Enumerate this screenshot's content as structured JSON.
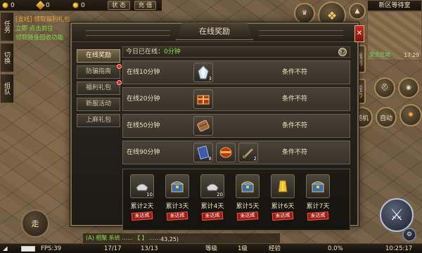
{
  "hud": {
    "res1": "0",
    "res2": "0",
    "res3": "0",
    "status_btn": "状 态",
    "recharge_btn": "充 值",
    "quest_tabs": [
      "任务",
      "切换",
      "组队"
    ],
    "quest_line1": "[支线] 领取福利礼包",
    "quest_line2": "立即 点击前往",
    "quest_line3": "领取随身回收功能",
    "minimap_title": "新区等待室",
    "safe_area": "安全区域",
    "minimap_time": "17:29",
    "welfare": "福利",
    "right_buttons": [
      "周历",
      "随机",
      "自动"
    ]
  },
  "dialog": {
    "title": "在线奖励",
    "close": "✕",
    "side_menu": [
      {
        "label": "在线奖励",
        "active": true,
        "dot": false
      },
      {
        "label": "防骗指南",
        "active": false,
        "dot": true
      },
      {
        "label": "福利礼包",
        "active": false,
        "dot": true
      },
      {
        "label": "新服活动",
        "active": false,
        "dot": false
      },
      {
        "label": "上麻礼包",
        "active": false,
        "dot": false
      }
    ],
    "today_label": "今日已在线：",
    "today_value": "0分钟",
    "help": "?",
    "rows": [
      {
        "label": "在线10分钟",
        "status": "条件不符",
        "items": [
          {
            "icon": "crystal-icon",
            "count": "3"
          }
        ]
      },
      {
        "label": "在线20分钟",
        "status": "条件不符",
        "items": [
          {
            "icon": "gift-box-icon",
            "count": ""
          }
        ]
      },
      {
        "label": "在线50分钟",
        "status": "条件不符",
        "items": [
          {
            "icon": "scroll-icon",
            "count": ""
          }
        ]
      },
      {
        "label": "在线90分钟",
        "status": "条件不符",
        "items": [
          {
            "icon": "spellbook-icon",
            "count": "8"
          },
          {
            "icon": "treasure-drum-icon",
            "count": ""
          },
          {
            "icon": "horn-icon",
            "count": "2"
          }
        ]
      }
    ],
    "cumulative": [
      {
        "day": "累计2天",
        "icon": "ingot-icon",
        "count": "10",
        "stamp": "未达成"
      },
      {
        "day": "累计3天",
        "icon": "chest-icon",
        "count": "",
        "stamp": "未达成"
      },
      {
        "day": "累计4天",
        "icon": "ingot-icon",
        "count": "20",
        "stamp": "未达成"
      },
      {
        "day": "累计5天",
        "icon": "chest-icon",
        "count": "",
        "stamp": "未达成"
      },
      {
        "day": "累计6天",
        "icon": "gold-bar-icon",
        "count": "",
        "stamp": "未达成"
      },
      {
        "day": "累计7天",
        "icon": "chest-icon",
        "count": "",
        "stamp": "未达成"
      }
    ]
  },
  "bottom": {
    "fps": "FPS:39",
    "hp": "17/17",
    "mp": "13/13",
    "level_label": "等级",
    "level_value": "1级",
    "exp_label": "经验",
    "exp_value": "0.0%",
    "clock": "10:25:17",
    "coords": "43,25)",
    "joystick": "走",
    "chat": "(A) 相聚 系统 ...... 【 】 ......"
  }
}
